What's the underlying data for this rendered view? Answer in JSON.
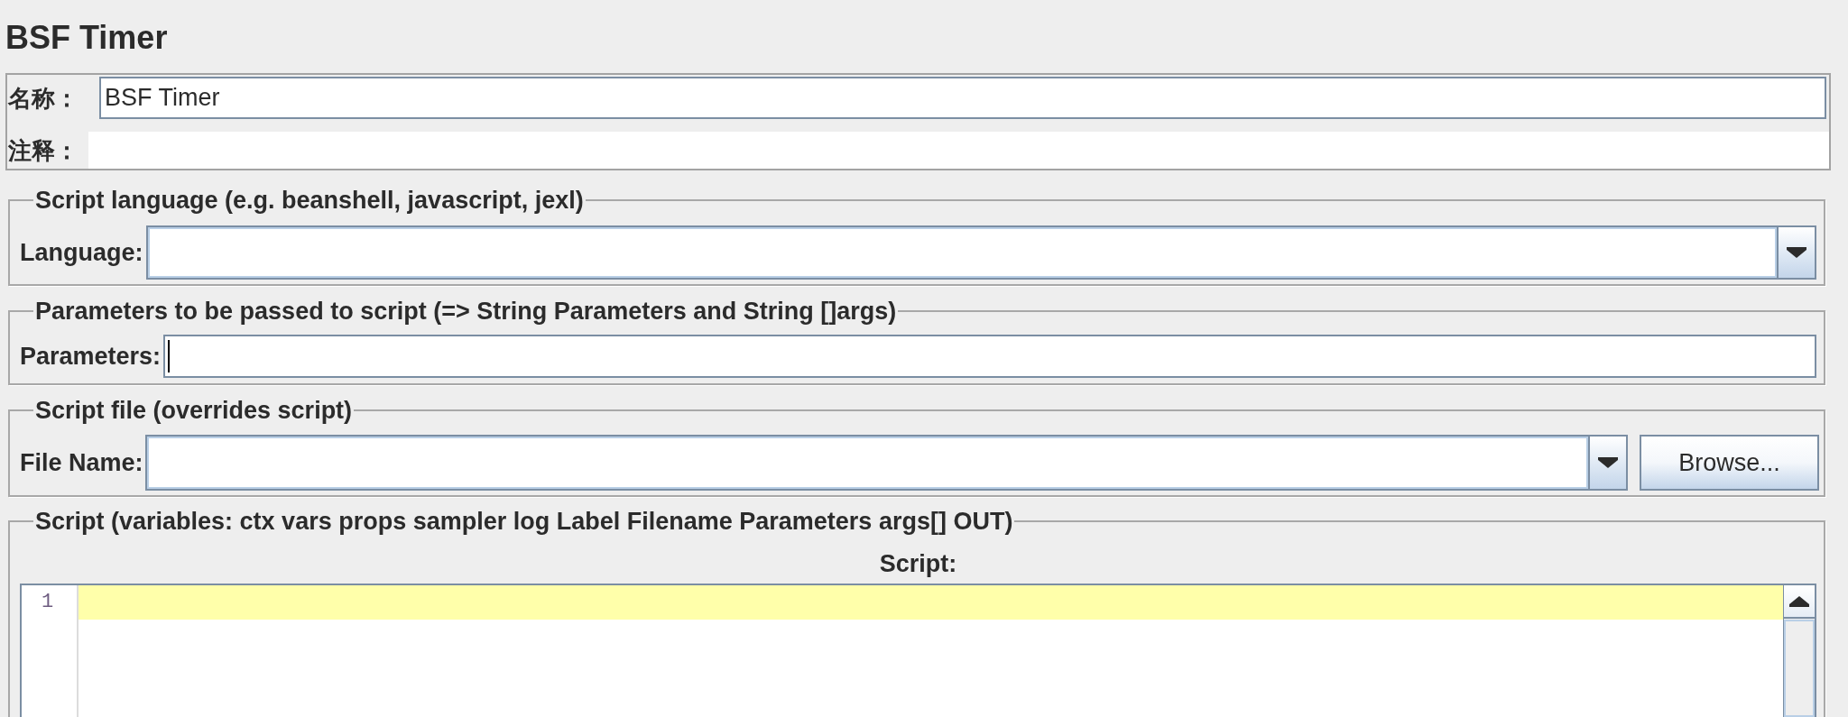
{
  "title": "BSF Timer",
  "name_field": {
    "label": "名称：",
    "value": "BSF Timer"
  },
  "comment_field": {
    "label": "注释："
  },
  "sections": [
    {
      "kind": "dropdown",
      "legend": "Script language (e.g. beanshell, javascript, jexl)",
      "label": "Language:"
    },
    {
      "kind": "text",
      "legend": "Parameters to be passed to script (=> String Parameters and String []args)",
      "label": "Parameters:",
      "focused": true
    },
    {
      "kind": "file",
      "legend": "Script file (overrides script)",
      "label": "File Name:",
      "button": "Browse..."
    },
    {
      "kind": "editor",
      "legend": "Script (variables: ctx vars props sampler log Label Filename Parameters args[] OUT)",
      "label": "Script:",
      "lines": [
        {
          "number": "1",
          "current": true
        }
      ]
    }
  ]
}
